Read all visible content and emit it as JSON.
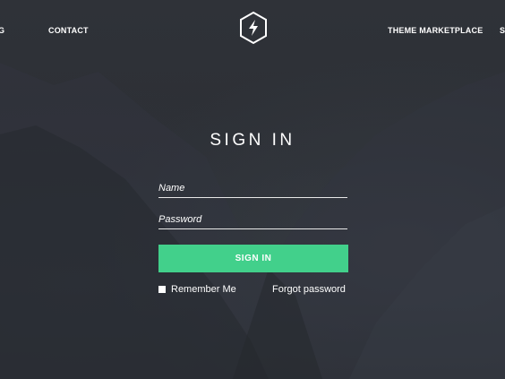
{
  "nav": {
    "left_partial": "G",
    "contact": "CONTACT",
    "marketplace": "THEME MARKETPLACE",
    "right_partial": "S"
  },
  "logo": {
    "icon": "lightning-bolt-hexagon-icon"
  },
  "form": {
    "title": "SIGN IN",
    "name_placeholder": "Name",
    "password_placeholder": "Password",
    "submit_label": "SIGN IN",
    "remember_label": "Remember Me",
    "forgot_label": "Forgot password"
  },
  "colors": {
    "background": "#2a2d33",
    "accent": "#42d08b",
    "text": "#ffffff"
  }
}
